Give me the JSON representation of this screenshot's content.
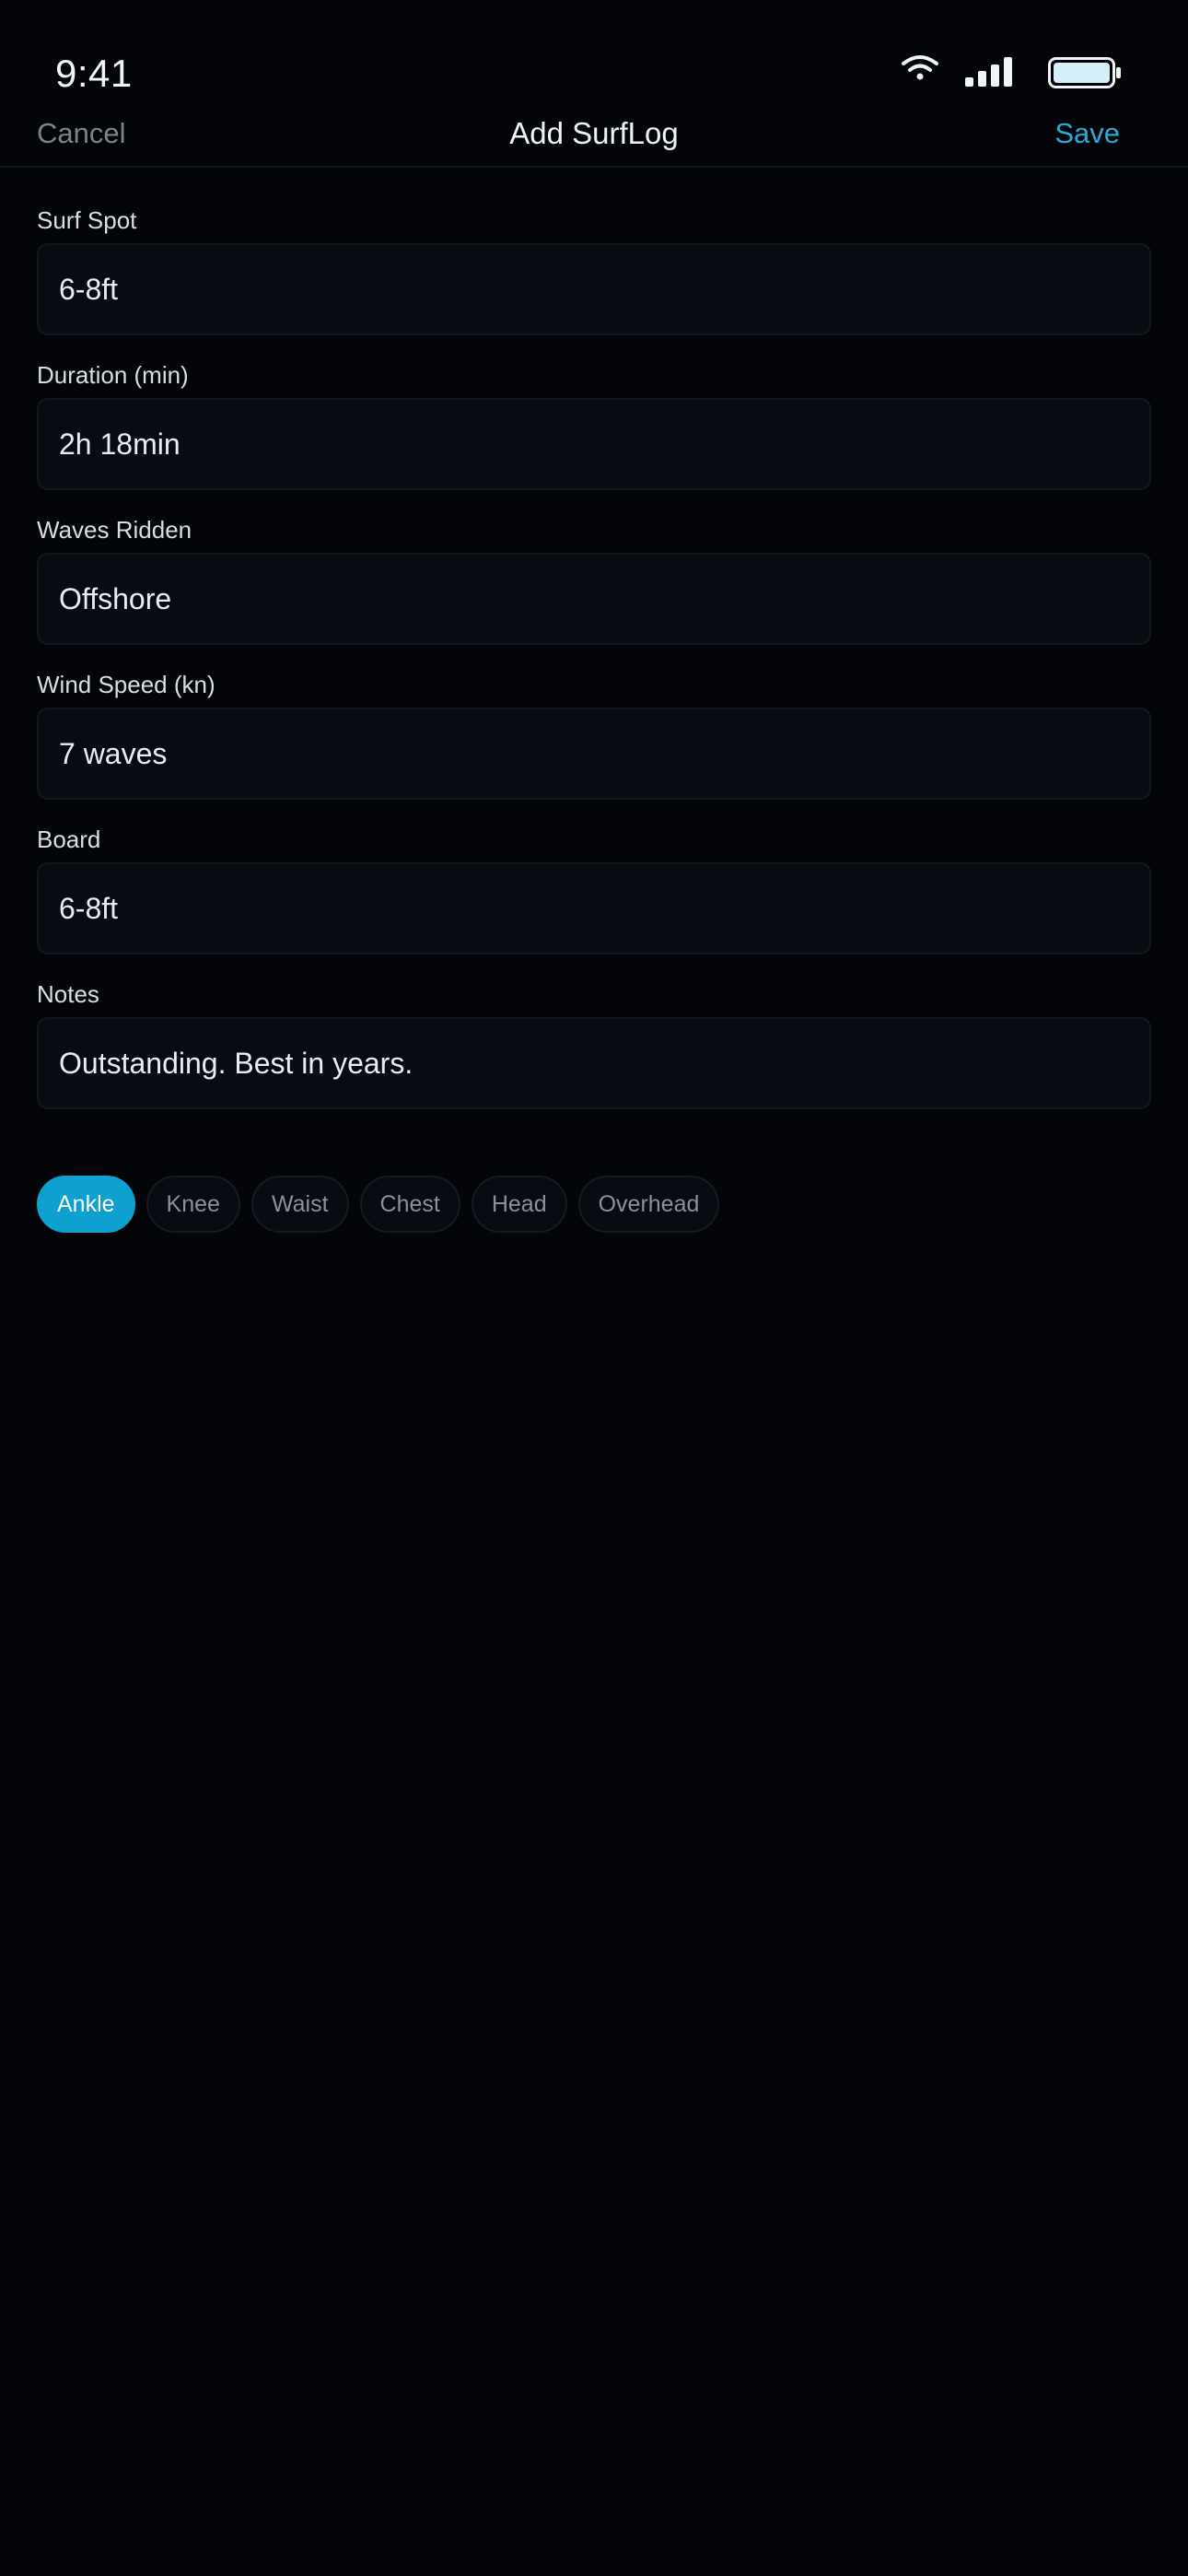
{
  "status_bar": {
    "time": "9:41"
  },
  "nav": {
    "cancel_label": "Cancel",
    "title": "Add SurfLog",
    "save_label": "Save"
  },
  "form": {
    "fields": [
      {
        "label": "Surf Spot",
        "value": "6-8ft"
      },
      {
        "label": "Duration (min)",
        "value": "2h 18min"
      },
      {
        "label": "Waves Ridden",
        "value": "Offshore"
      },
      {
        "label": "Wind Speed (kn)",
        "value": "7 waves"
      },
      {
        "label": "Board",
        "value": "6-8ft"
      },
      {
        "label": "Notes",
        "value": "Outstanding. Best in years."
      }
    ]
  },
  "wave_height_chips": {
    "selected": "Ankle",
    "options": [
      "Ankle",
      "Knee",
      "Waist",
      "Chest",
      "Head",
      "Overhead"
    ]
  },
  "colors": {
    "background": "#030508",
    "accent": "#0ea0cf",
    "save": "#2aa8d6",
    "field_bg": "#080c12"
  }
}
